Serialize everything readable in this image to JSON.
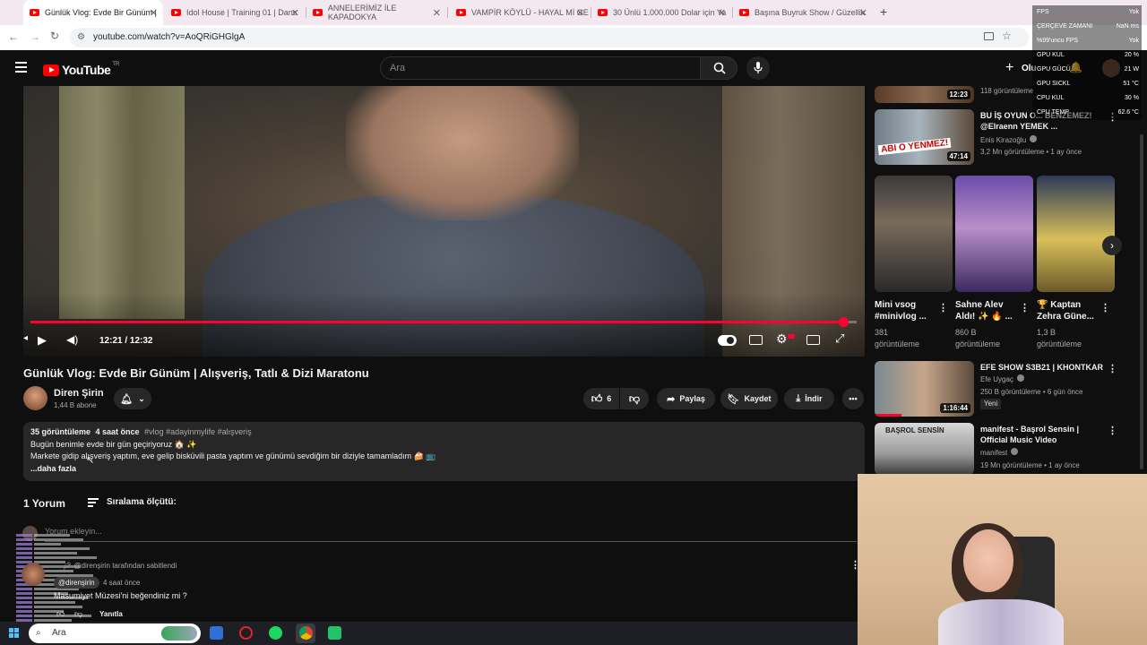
{
  "browser": {
    "tabs": [
      {
        "title": "Günlük Vlog: Evde Bir Günüm |",
        "active": true
      },
      {
        "title": "Idol House | Training 01 | Dans",
        "active": false
      },
      {
        "title": "ANNELERİMİZ İLE KAPADOKYA",
        "active": false
      },
      {
        "title": "VAMPİR KÖYLÜ - HAYAL Mİ GE",
        "active": false
      },
      {
        "title": "30 Ünlü 1.000.000 Dolar için Ya",
        "active": false
      },
      {
        "title": "Başına Buyruk Show / Güzellik",
        "active": false
      }
    ],
    "new_tab_label": "+",
    "url": "youtube.com/watch?v=AoQRiGHGlgA"
  },
  "youtube": {
    "logo_text": "YouTube",
    "logo_region": "TR",
    "search_placeholder": "Ara",
    "create_label": "Olu",
    "colors": {
      "accent": "#ff0000",
      "progress": "#ff0033"
    }
  },
  "player": {
    "time": "12:21 / 12:32",
    "progress_fraction": 0.984
  },
  "video": {
    "title": "Günlük Vlog: Evde Bir Günüm | Alışveriş, Tatlı & Dizi Maratonu",
    "channel": "Diren Şirin",
    "subscribers": "1,44 B abone",
    "likes": "6",
    "share_label": "Paylaş",
    "save_label": "Kaydet",
    "download_label": "İndir"
  },
  "description": {
    "views": "35 görüntüleme",
    "posted": "4 saat önce",
    "tags": "#vlog #adayinmylife #alışveriş",
    "line1": "Bugün benimle evde bir gün geçiriyoruz 🏠 ✨",
    "line2": "Markete gidip alışveriş yaptım, eve gelip bisküvili pasta yaptım ve günümü sevdiğim bir diziyle tamamladım 🍰 📺",
    "more": "...daha fazla"
  },
  "comments": {
    "count_label": "1 Yorum",
    "sort_label": "Sıralama ölçütü:",
    "add_placeholder": "Yorum ekleyin...",
    "pinned_by": "@direnşirin tarafından sabitlendi",
    "author": "@direnşirin",
    "time": "4 saat önce",
    "text": "Masumiyet Müzesi'ni beğendiniz mi ?",
    "reply_label": "Yanıtla"
  },
  "sidebar": [
    {
      "meta1": "118 görüntüleme",
      "duration": "12:23"
    },
    {
      "title": "BU İŞ OYUN O... BENZEMEZ! @Elraenn YEMEK ...",
      "channel": "Enis Kirazoğlu",
      "meta": "3,2 Mn görüntüleme • 1 ay önce",
      "duration": "47:14",
      "thumb_text": "ABI O YENMEZ!"
    },
    {
      "shorts": [
        {
          "title": "Mini vsog #minivlog ...",
          "views": "381",
          "views_label": "görüntüleme"
        },
        {
          "title": "Sahne Alev Aldı! ✨ 🔥 ...",
          "views": "860 B",
          "views_label": "görüntüleme"
        },
        {
          "title": "🏆 Kaptan Zehra Güne...",
          "views": "1,3 B",
          "views_label": "görüntüleme"
        }
      ]
    },
    {
      "title": "EFE SHOW S3B21 | KHONTKAR",
      "channel": "Efe Uygaç",
      "meta": "250 B görüntüleme • 6 gün önce",
      "badge": "Yeni",
      "duration": "1:16:44"
    },
    {
      "title": "manifest - Başrol Sensin | Official Music Video",
      "channel": "manifest",
      "meta": "19 Mn görüntüleme • 1 ay önce",
      "thumb_text": "BAŞROL SENSİN"
    }
  ],
  "fps_overlay": [
    {
      "label": "FPS",
      "value": "Yok"
    },
    {
      "label": "ÇERÇEVE ZAMANI",
      "value": "NaN ms"
    },
    {
      "label": "%99'uncu FPS",
      "value": "Yok"
    },
    {
      "label": "GPU KUL",
      "value": "20 %"
    },
    {
      "label": "GPU GÜCÜ",
      "value": "21 W"
    },
    {
      "label": "GPU SICKL",
      "value": "51 °C"
    },
    {
      "label": "CPU KUL",
      "value": "30 %"
    },
    {
      "label": "CPU TEMP",
      "value": "62.6 °C"
    }
  ],
  "taskbar": {
    "search_placeholder": "Ara"
  }
}
